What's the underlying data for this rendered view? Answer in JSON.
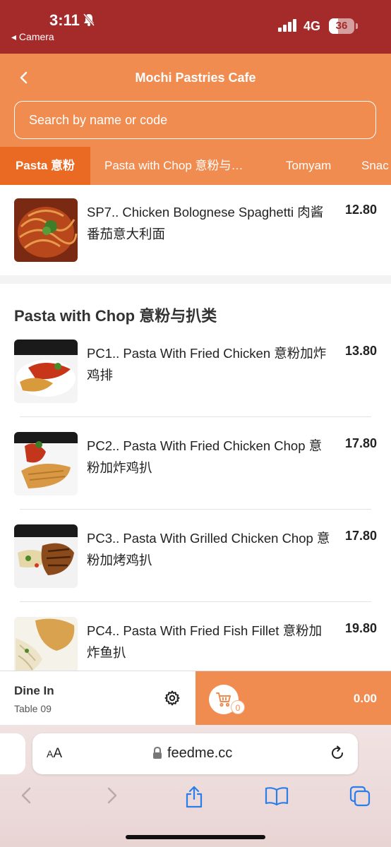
{
  "status_bar": {
    "time": "3:11",
    "back_app": "◂ Camera",
    "network": "4G",
    "battery": "36"
  },
  "header": {
    "title": "Mochi Pastries Cafe",
    "search_placeholder": "Search by name or code"
  },
  "tabs": [
    {
      "label": "Pasta 意粉",
      "active": true
    },
    {
      "label": "Pasta with Chop 意粉与…",
      "active": false
    },
    {
      "label": "Tomyam",
      "active": false
    },
    {
      "label": "Snac",
      "active": false
    }
  ],
  "sections": [
    {
      "items": [
        {
          "name": "SP7.. Chicken Bolognese Spaghetti 肉酱番茄意大利面",
          "price": "12.80"
        }
      ]
    },
    {
      "title": "Pasta with Chop 意粉与扒类",
      "items": [
        {
          "name": "PC1.. Pasta With Fried Chicken 意粉加炸鸡排",
          "price": "13.80"
        },
        {
          "name": "PC2.. Pasta With Fried Chicken Chop 意粉加炸鸡扒",
          "price": "17.80"
        },
        {
          "name": "PC3.. Pasta With Grilled Chicken Chop 意粉加烤鸡扒",
          "price": "17.80"
        },
        {
          "name": "PC4.. Pasta With Fried Fish Fillet 意粉加炸鱼扒",
          "price": "19.80"
        }
      ]
    }
  ],
  "order_bar": {
    "mode": "Dine In",
    "table": "Table 09",
    "cart_count": "0",
    "total": "0.00"
  },
  "browser": {
    "aa_label_small": "A",
    "aa_label_large": "A",
    "url": "feedme.cc"
  },
  "colors": {
    "status_bar": "#a52a2a",
    "header": "#f08c50",
    "active_tab": "#ea6a24"
  }
}
